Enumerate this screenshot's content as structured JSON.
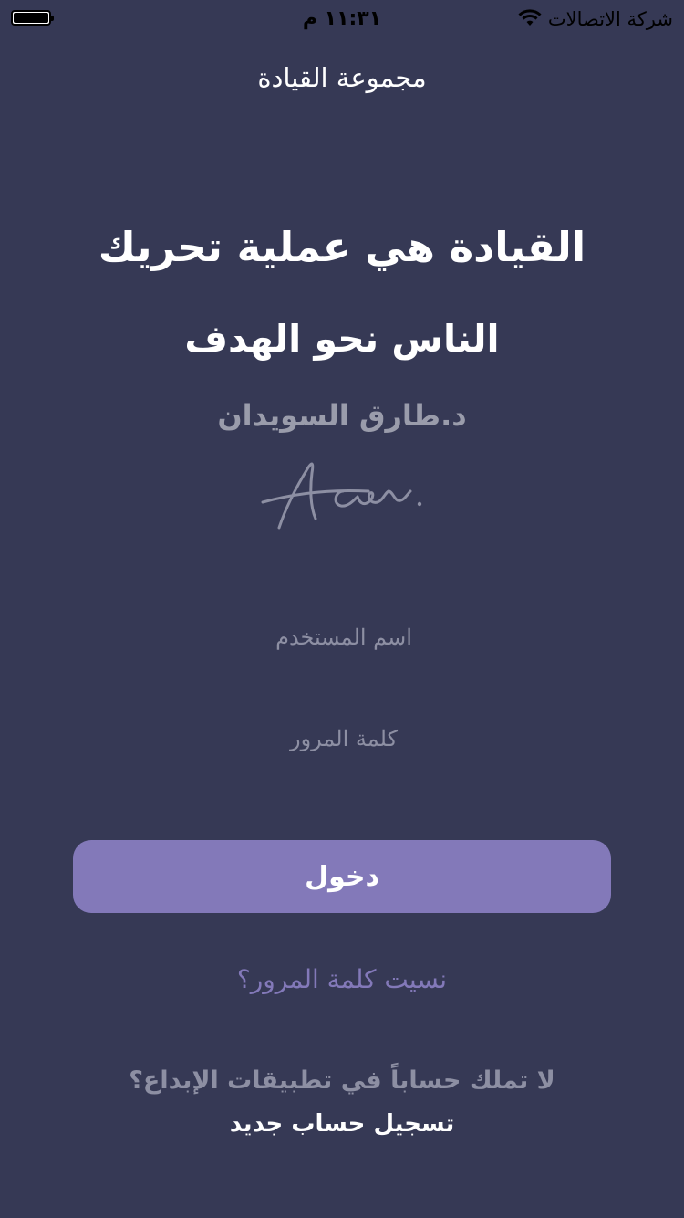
{
  "status_bar": {
    "carrier": "شركة الاتصالات",
    "time": "١١:٣١ م",
    "wifi_icon": "wifi-icon",
    "battery_icon": "battery-icon",
    "battery_level": 1.0
  },
  "header": {
    "app_name": "مجموعة القيادة"
  },
  "quote": {
    "line1": "القيادة هي عملية تحريك",
    "line2": "الناس نحو الهدف",
    "author": "د.طارق السويدان",
    "signature_text": "Aen."
  },
  "login_form": {
    "username_placeholder": "اسم المستخدم",
    "username_value": "",
    "password_placeholder": "كلمة المرور",
    "password_value": "",
    "login_label": "دخول"
  },
  "links": {
    "forgot_password": "نسيت كلمة المرور؟",
    "no_account": "لا تملك حساباً في تطبيقات الإبداع؟",
    "register": "تسجيل حساب جديد"
  },
  "colors": {
    "background": "#363955",
    "accent": "#8379b9",
    "muted_text": "#8d8fa3"
  }
}
